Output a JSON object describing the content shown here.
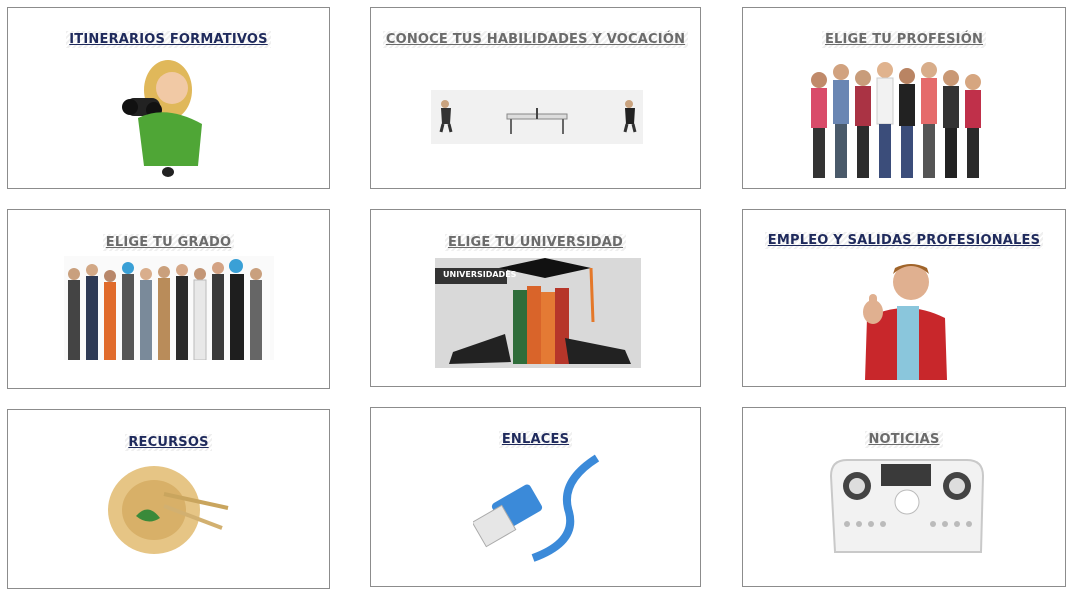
{
  "cards": [
    {
      "title": "ITINERARIOS FORMATIVOS",
      "image_icon": "binoculars-girl-icon",
      "title_color": "#1f2a5c"
    },
    {
      "title": "CONOCE TUS HABILIDADES Y VOCACIÓN",
      "image_icon": "ping-pong-icon",
      "title_color": "#6b6b6b"
    },
    {
      "title": "ELIGE TU PROFESIÓN",
      "image_icon": "group-of-people-icon",
      "title_color": "#6b6b6b"
    },
    {
      "title": "ELIGE TU GRADO",
      "image_icon": "professionals-group-icon",
      "title_color": "#6b6b6b"
    },
    {
      "title": "ELIGE TU UNIVERSIDAD",
      "image_icon": "books-graduation-cap-icon",
      "title_color": "#6b6b6b",
      "image_label": "UNIVERSIDADES"
    },
    {
      "title": "EMPLEO Y SALIDAS PROFESIONALES",
      "image_icon": "thumbs-up-man-icon",
      "title_color": "#1f2a5c"
    },
    {
      "title": "RECURSOS",
      "image_icon": "plate-fork-knife-icon",
      "title_color": "#1f2a5c"
    },
    {
      "title": "ENLACES",
      "image_icon": "network-cable-icon",
      "title_color": "#1f2a5c"
    },
    {
      "title": "NOTICIAS",
      "image_icon": "radio-device-icon",
      "title_color": "#6b6b6b"
    }
  ]
}
